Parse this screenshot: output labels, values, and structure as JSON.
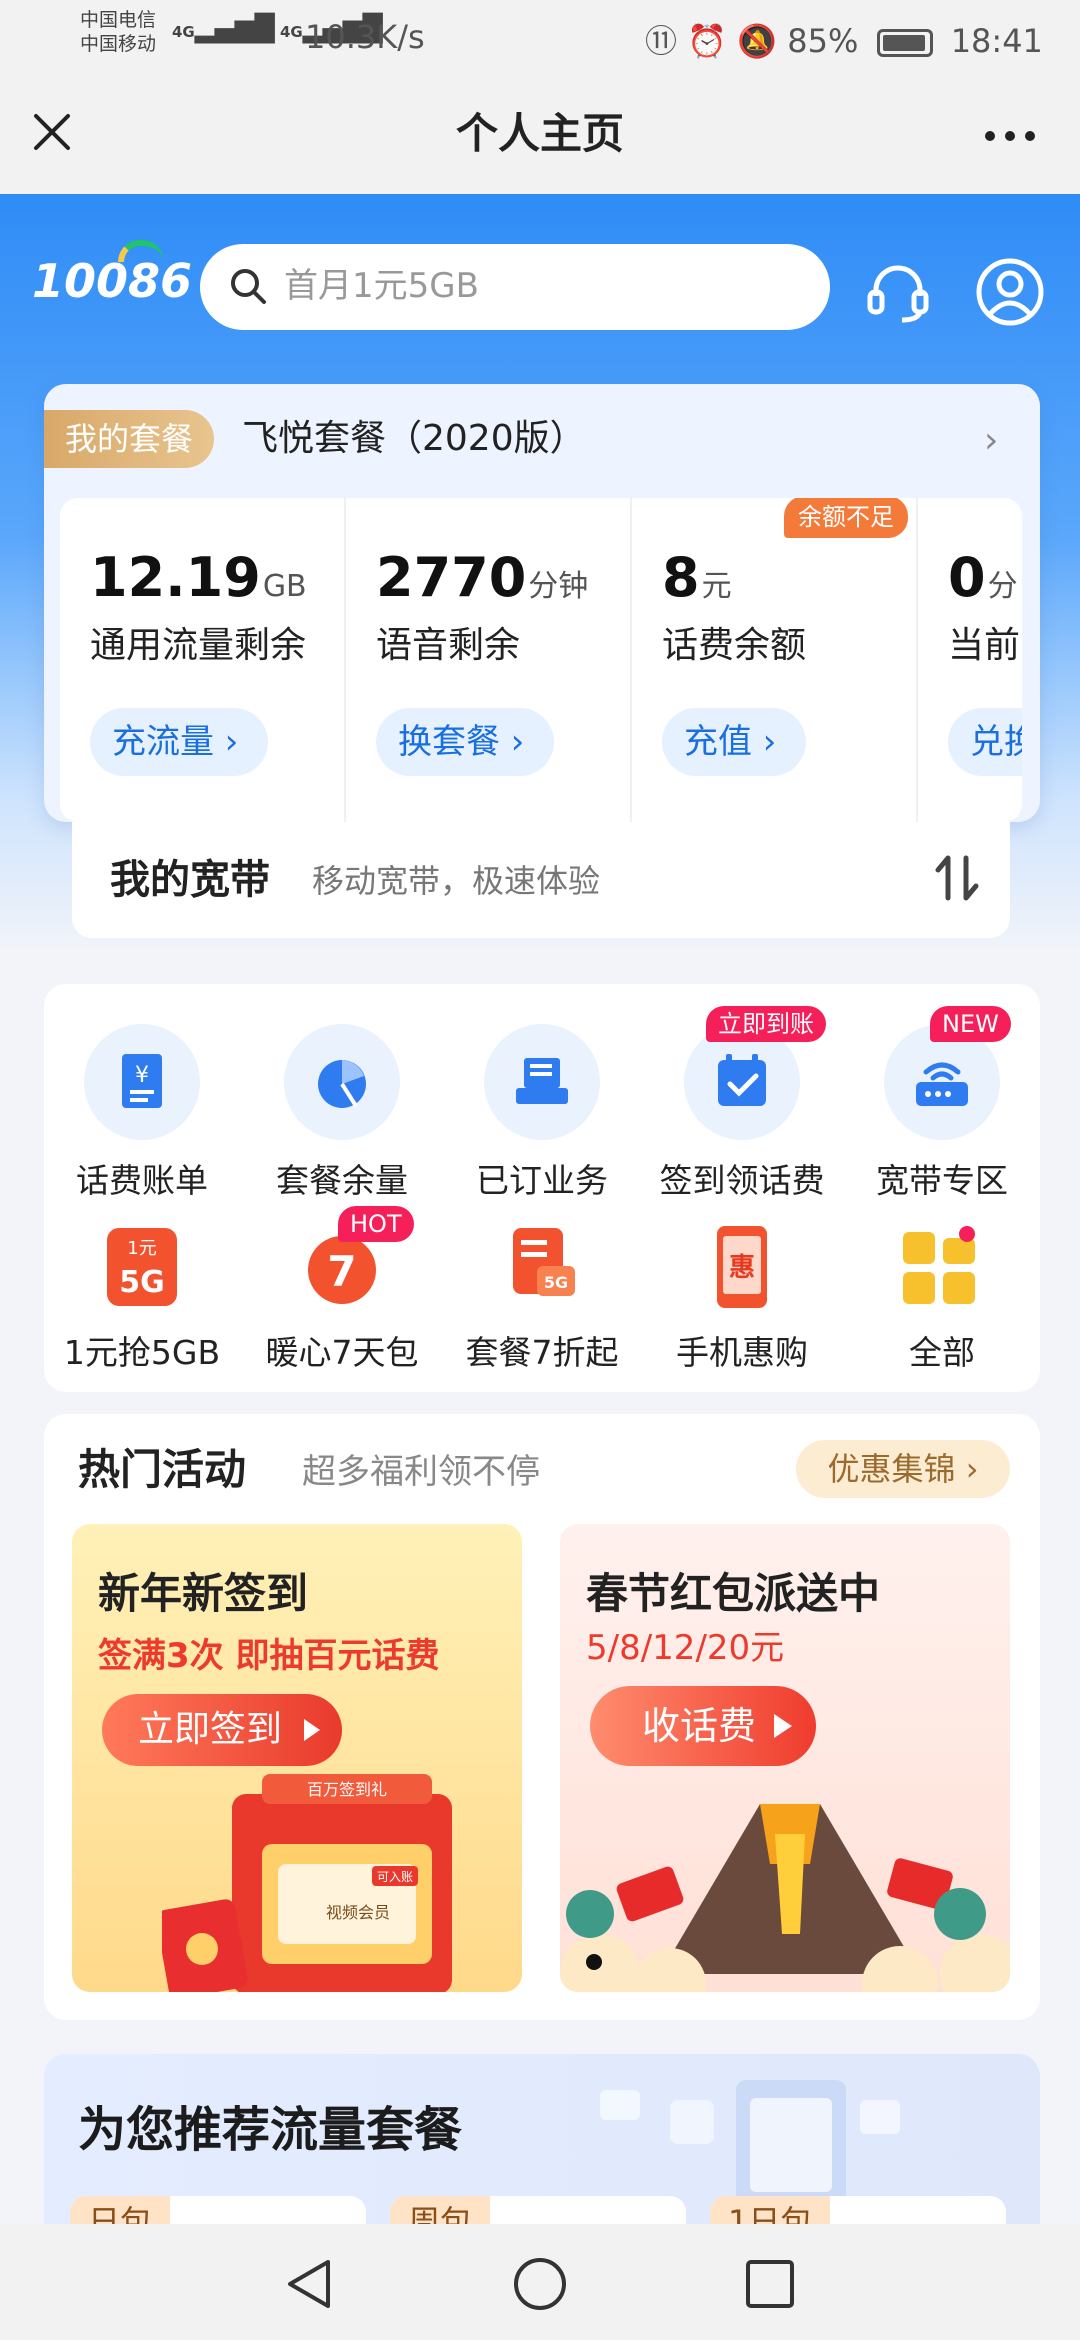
{
  "status_bar": {
    "carrier1": "中国电信",
    "carrier2": "中国移动",
    "signal": "4G",
    "net_speed": "10.3K/s",
    "battery": "85%",
    "time": "18:41"
  },
  "titlebar": {
    "title": "个人主页"
  },
  "header": {
    "logo": "10086",
    "search_placeholder": "首月1元5GB"
  },
  "package": {
    "tag": "我的套餐",
    "name": "飞悦套餐（2020版）",
    "stats": [
      {
        "value": "12.19",
        "unit": "GB",
        "label": "通用流量剩余",
        "button": "充流量"
      },
      {
        "value": "2770",
        "unit": "分钟",
        "label": "语音剩余",
        "button": "换套餐"
      },
      {
        "value": "8",
        "unit": "元",
        "label": "话费余额",
        "button": "充值",
        "badge": "余额不足"
      },
      {
        "value": "0",
        "unit": "分",
        "label": "当前",
        "button": "兑换"
      }
    ]
  },
  "broadband": {
    "title": "我的宽带",
    "subtitle": "移动宽带，极速体验"
  },
  "quick": {
    "row1": [
      {
        "label": "话费账单"
      },
      {
        "label": "套餐余量"
      },
      {
        "label": "已订业务"
      },
      {
        "label": "签到领话费",
        "badge": "立即到账"
      },
      {
        "label": "宽带专区",
        "badge": "NEW"
      }
    ],
    "row2": [
      {
        "label": "1元抢5GB",
        "icon_text1": "1元",
        "icon_text2": "5G"
      },
      {
        "label": "暖心7天包",
        "badge": "HOT",
        "icon_text1": "7"
      },
      {
        "label": "套餐7折起",
        "icon_text1": "5G"
      },
      {
        "label": "手机惠购",
        "icon_text1": "惠"
      },
      {
        "label": "全部"
      }
    ]
  },
  "hot": {
    "title": "热门活动",
    "subtitle": "超多福利领不停",
    "link": "优惠集锦",
    "banners": [
      {
        "title": "新年新签到",
        "sub": "签满3次  即抽百元话费",
        "button": "立即签到",
        "deco1": "百万签到礼",
        "deco2": "视频会员",
        "deco3": "可入账"
      },
      {
        "title": "春节红包派送中",
        "sub": "5/8/12/20元",
        "button": "收话费"
      }
    ]
  },
  "recommend": {
    "title": "为您推荐流量套餐",
    "cards": [
      "日包",
      "周包",
      "1日包"
    ]
  },
  "colors": {
    "brand_blue": "#2f8cf6",
    "accent_red": "#f5205a",
    "gold": "#d8a868"
  }
}
